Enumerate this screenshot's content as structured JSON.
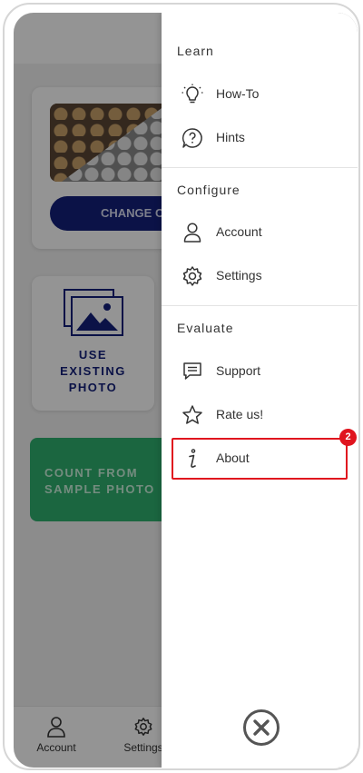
{
  "background": {
    "change_button_label": "CHANGE CO",
    "use_existing_photo_label": "USE\nEXISTING\nPHOTO",
    "sample_photo_label": "COUNT FROM\nSAMPLE PHOTO",
    "bottom_nav": [
      {
        "label": "Account",
        "icon": "person-icon"
      },
      {
        "label": "Settings",
        "icon": "gear-icon"
      }
    ]
  },
  "drawer": {
    "sections": [
      {
        "title": "Learn",
        "items": [
          {
            "label": "How-To",
            "icon": "lightbulb-icon"
          },
          {
            "label": "Hints",
            "icon": "question-bubble-icon"
          }
        ]
      },
      {
        "title": "Configure",
        "items": [
          {
            "label": "Account",
            "icon": "person-icon"
          },
          {
            "label": "Settings",
            "icon": "gear-icon"
          }
        ]
      },
      {
        "title": "Evaluate",
        "items": [
          {
            "label": "Support",
            "icon": "chat-icon"
          },
          {
            "label": "Rate us!",
            "icon": "star-icon"
          },
          {
            "label": "About",
            "icon": "info-icon"
          }
        ]
      }
    ],
    "highlight_badge": "2",
    "close_icon": "close-circle-icon"
  },
  "colors": {
    "accent_navy": "#13207a",
    "accent_green": "#2fb06f",
    "highlight_red": "#e0141e"
  }
}
